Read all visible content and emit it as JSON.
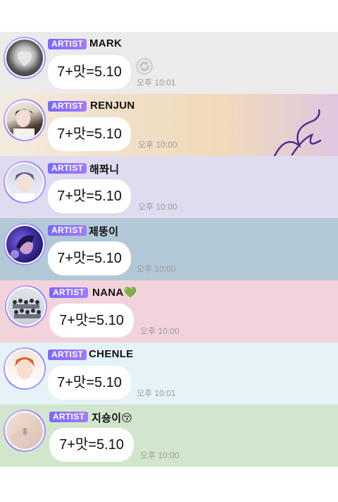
{
  "messages": [
    {
      "badge": "ARTIST",
      "name": "MARK",
      "message": "7+맛=5.10",
      "time": "오후 10:01",
      "bg": "#ebebeb"
    },
    {
      "badge": "ARTIST",
      "name": "RENJUN",
      "message": "7+맛=5.10",
      "time": "오후 10:00",
      "bg": "#efe3cf"
    },
    {
      "badge": "ARTIST",
      "name": "해쫘니",
      "message": "7+맛=5.10",
      "time": "오후 10:00",
      "bg": "#e1dbef"
    },
    {
      "badge": "ARTIST",
      "name": "제뚱이",
      "message": "7+맛=5.10",
      "time": "오후 10:00",
      "bg": "#b2c8d7"
    },
    {
      "badge": "ARTIST",
      "name": "NANA💚",
      "message": "7+맛=5.10",
      "time": "오후 10:00",
      "bg": "#f3d3db"
    },
    {
      "badge": "ARTIST",
      "name": "CHENLE",
      "message": "7+맛=5.10",
      "time": "오후 10:01",
      "bg": "#e5f3f8"
    },
    {
      "badge": "ARTIST",
      "name": "지숑이😚",
      "message": "7+맛=5.10",
      "time": "오후 10:00",
      "bg": "#d2e6cd"
    }
  ]
}
